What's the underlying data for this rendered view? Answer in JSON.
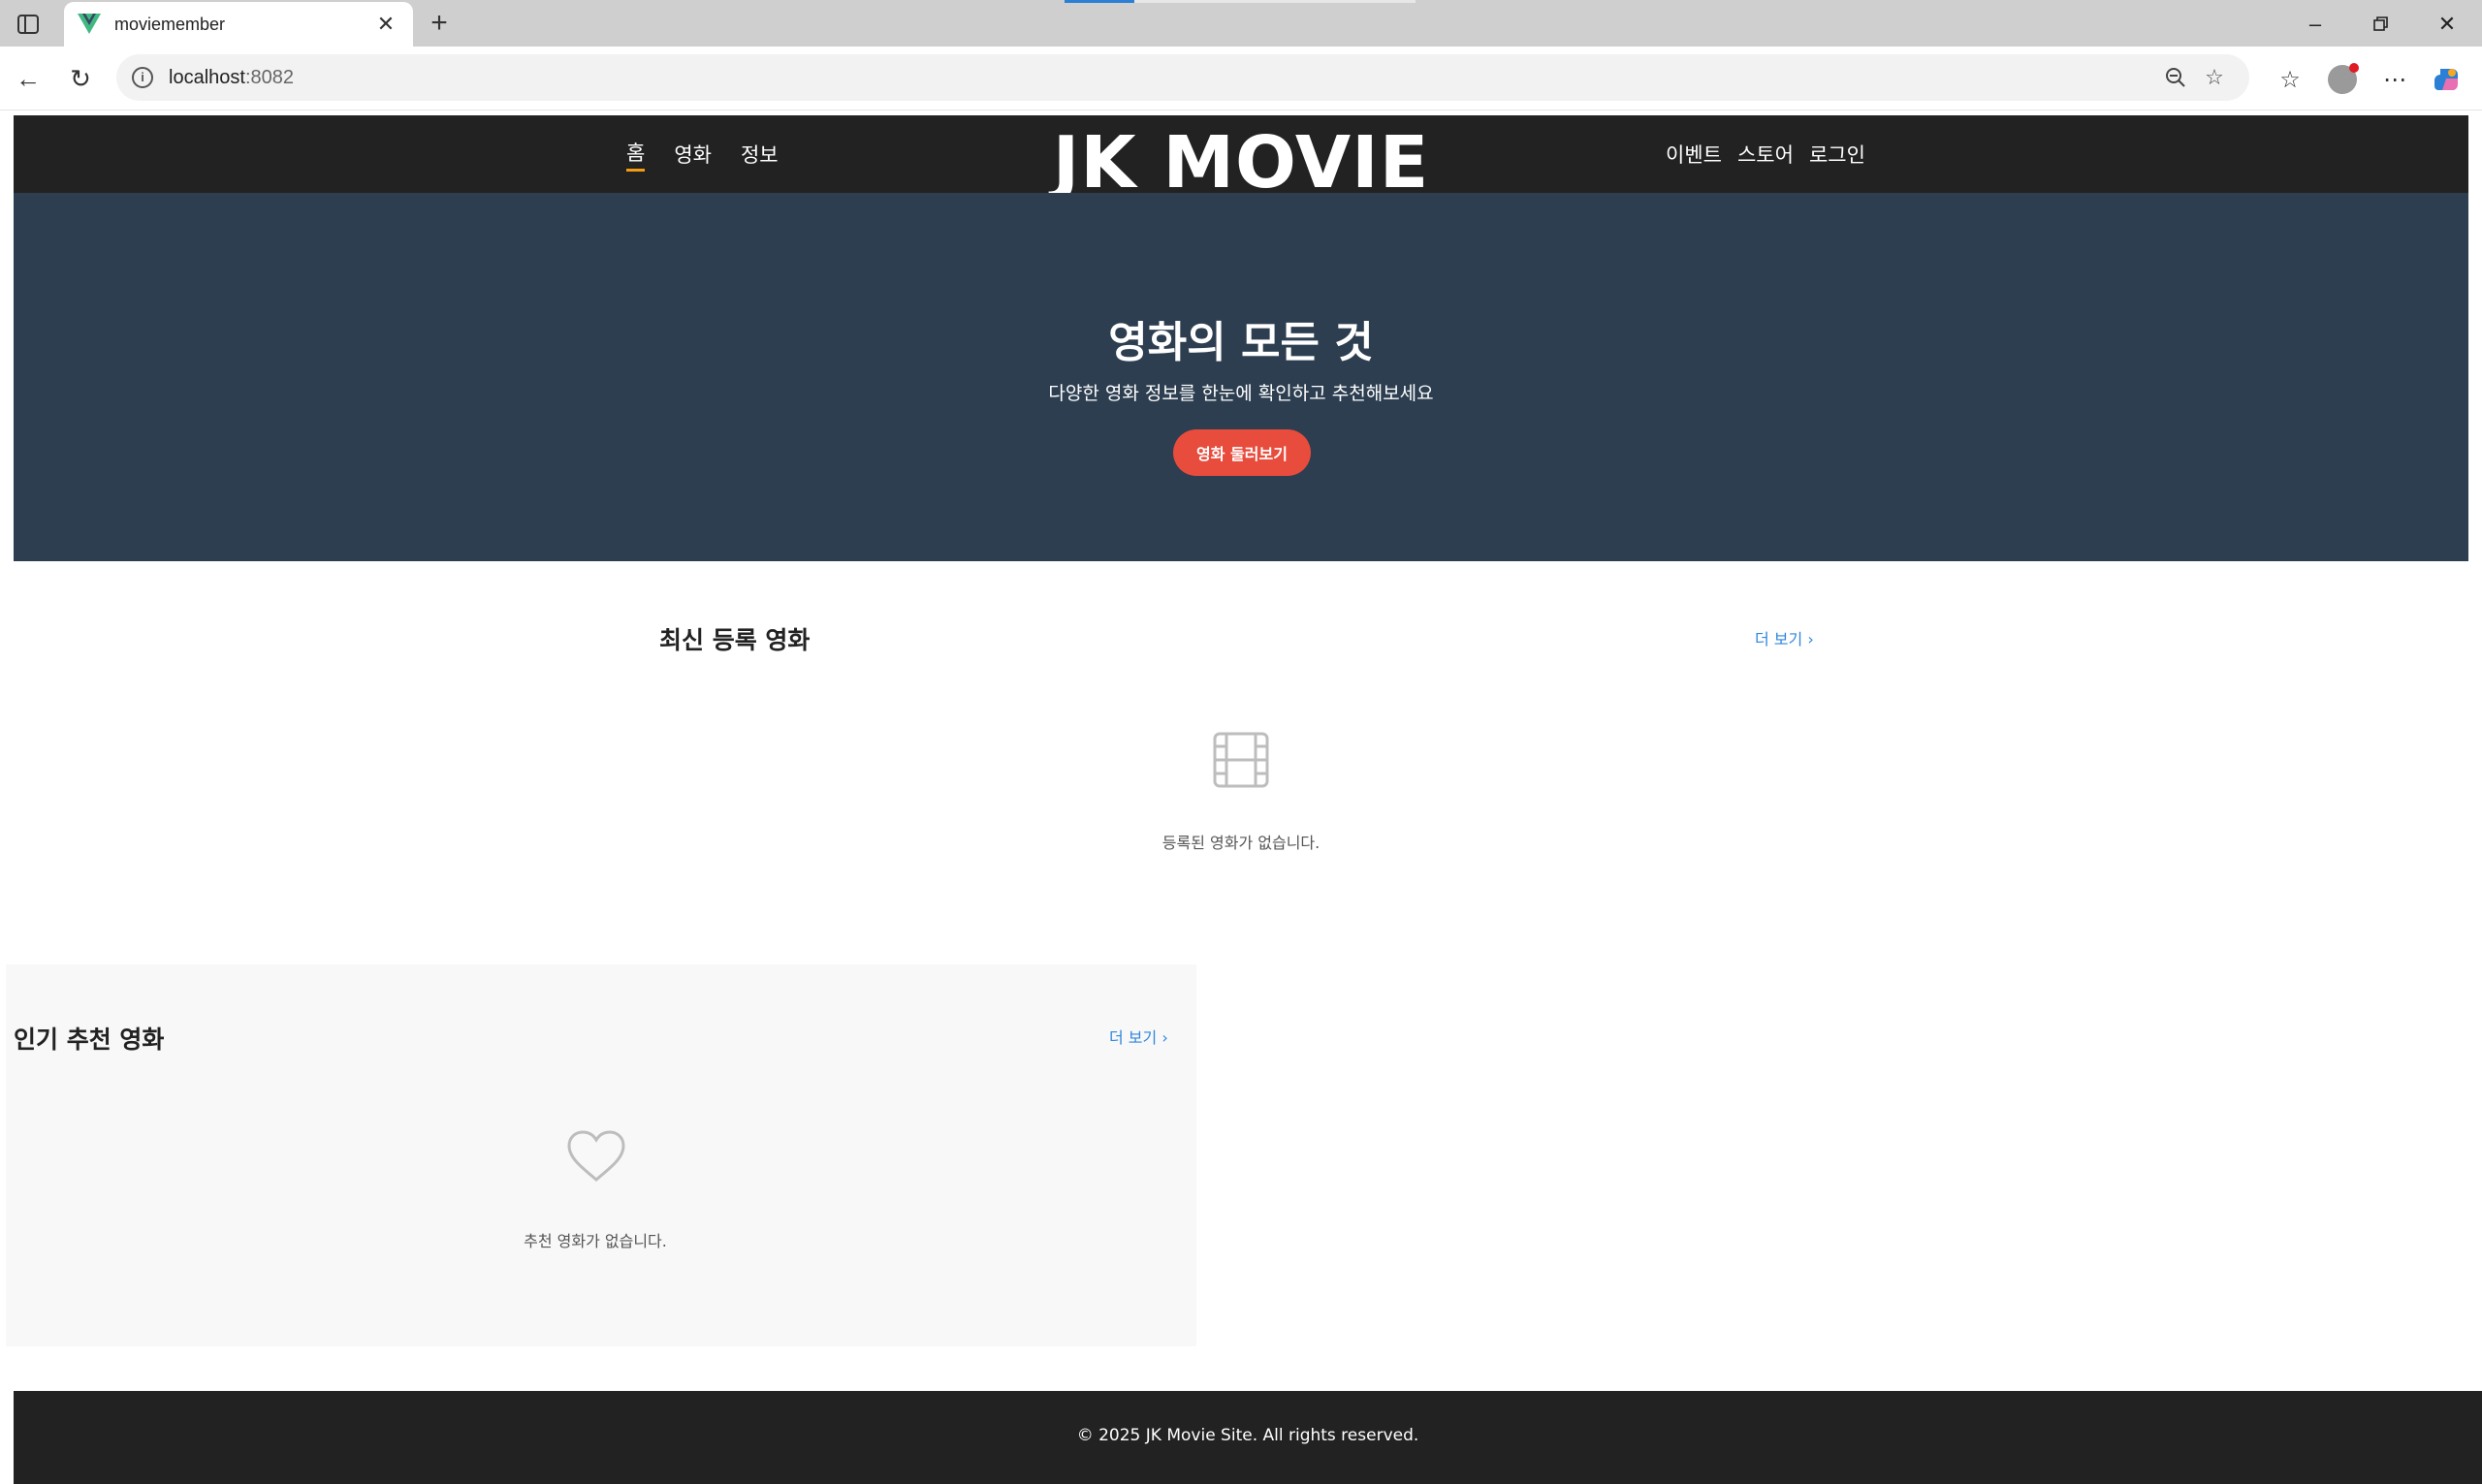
{
  "browser": {
    "tab_title": "moviemember",
    "url_host": "localhost",
    "url_port": ":8082"
  },
  "header": {
    "nav_left": [
      "홈",
      "영화",
      "정보"
    ],
    "logo": "JK MOVIE",
    "nav_right": [
      "이벤트",
      "스토어",
      "로그인"
    ],
    "active_item": "홈"
  },
  "hero": {
    "title": "영화의 모든 것",
    "subtitle": "다양한 영화 정보를 한눈에 확인하고 추천해보세요",
    "button_label": "영화 둘러보기",
    "background_color": "#2c3e50",
    "button_color": "#e74c3c"
  },
  "latest": {
    "title": "최신 등록 영화",
    "more_label": "더 보기",
    "empty_message": "등록된 영화가 없습니다.",
    "empty_icon": "film-icon"
  },
  "popular": {
    "title": "인기 추천 영화",
    "more_label": "더 보기",
    "empty_message": "추천 영화가 없습니다.",
    "empty_icon": "heart-icon"
  },
  "footer": {
    "text": "© 2025 JK Movie Site. All rights reserved."
  }
}
